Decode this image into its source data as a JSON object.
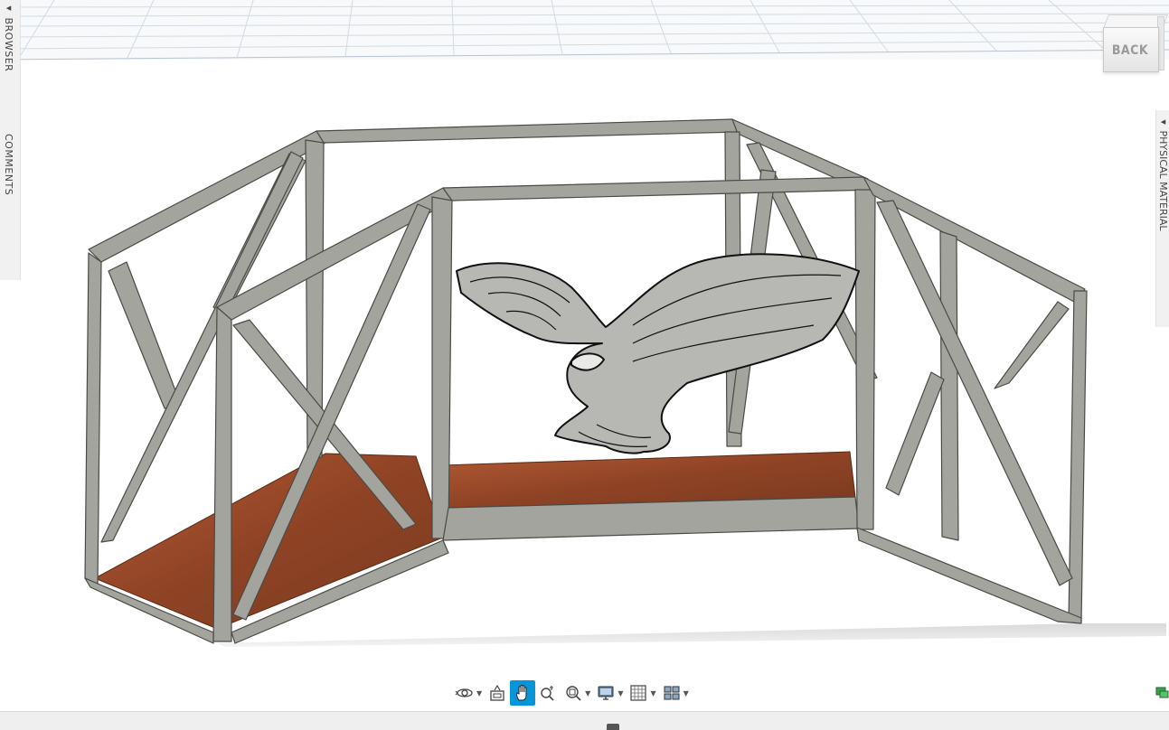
{
  "left_panel": {
    "browser_label": "◂ BROWSER",
    "comments_label": "COMMENTS"
  },
  "right_panel": {
    "physical_material_label": "◂ PHYSICAL MATERIAL"
  },
  "viewcube": {
    "face_label": "BACK"
  },
  "navbar": {
    "tools": [
      {
        "name": "orbit",
        "icon": "orbit-icon",
        "has_dropdown": true
      },
      {
        "name": "look-at",
        "icon": "look-at-icon",
        "has_dropdown": false
      },
      {
        "name": "pan",
        "icon": "pan-hand-icon",
        "has_dropdown": false,
        "active": true
      },
      {
        "name": "zoom",
        "icon": "zoom-icon",
        "has_dropdown": false
      },
      {
        "name": "fit",
        "icon": "zoom-window-icon",
        "has_dropdown": true
      },
      {
        "name": "display-settings",
        "icon": "monitor-icon",
        "has_dropdown": true
      },
      {
        "name": "grid-snaps",
        "icon": "grid-icon",
        "has_dropdown": true
      },
      {
        "name": "viewports",
        "icon": "viewports-icon",
        "has_dropdown": true
      }
    ]
  },
  "model": {
    "description_icon": "eagle-icon",
    "frame_color": "#a4a49e",
    "frame_dark": "#74746e",
    "floor_color": "#9a4a2a",
    "grid_color": "#cfd6de",
    "accent": "#0696d7"
  }
}
